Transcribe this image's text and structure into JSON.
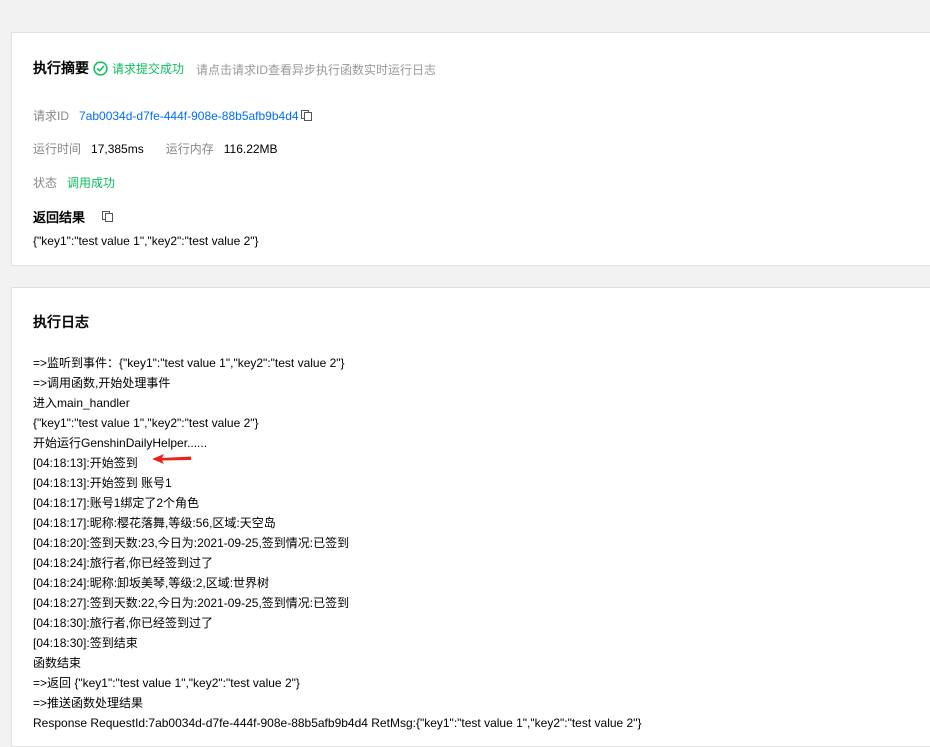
{
  "summary": {
    "title": "执行摘要",
    "status": "请求提交成功",
    "hint": "请点击请求ID查看异步执行函数实时运行日志",
    "request_id_label": "请求ID",
    "request_id": "7ab0034d-d7fe-444f-908e-88b5afb9b4d4",
    "runtime_label": "运行时间",
    "runtime": "17,385ms",
    "memory_label": "运行内存",
    "memory": "116.22MB",
    "state_label": "状态",
    "state": "调用成功",
    "result_title": "返回结果",
    "result": "{\"key1\":\"test value 1\",\"key2\":\"test value 2\"}"
  },
  "log": {
    "title": "执行日志",
    "lines": [
      "=>监听到事件：{\"key1\":\"test value 1\",\"key2\":\"test value 2\"}",
      "=>调用函数,开始处理事件",
      "进入main_handler",
      "{\"key1\":\"test value 1\",\"key2\":\"test value 2\"}",
      "开始运行GenshinDailyHelper......",
      "[04:18:13]:开始签到",
      "[04:18:13]:开始签到 账号1",
      "[04:18:17]:账号1绑定了2个角色",
      "[04:18:17]:昵称:樱花落舞,等级:56,区域:天空岛",
      "[04:18:20]:签到天数:23,今日为:2021-09-25,签到情况:已签到",
      "[04:18:24]:旅行者,你已经签到过了",
      "[04:18:24]:昵称:卸坂美琴,等级:2,区域:世界树",
      "[04:18:27]:签到天数:22,今日为:2021-09-25,签到情况:已签到",
      "[04:18:30]:旅行者,你已经签到过了",
      "[04:18:30]:签到结束",
      "函数结束",
      "=>返回 {\"key1\":\"test value 1\",\"key2\":\"test value 2\"}",
      "=>推送函数处理结果",
      "Response RequestId:7ab0034d-d7fe-444f-908e-88b5afb9b4d4 RetMsg:{\"key1\":\"test value 1\",\"key2\":\"test value 2\"}"
    ]
  },
  "colors": {
    "success": "#0abf5b",
    "link": "#006eff",
    "label": "#888888",
    "annotation_arrow": "#e8231b"
  }
}
